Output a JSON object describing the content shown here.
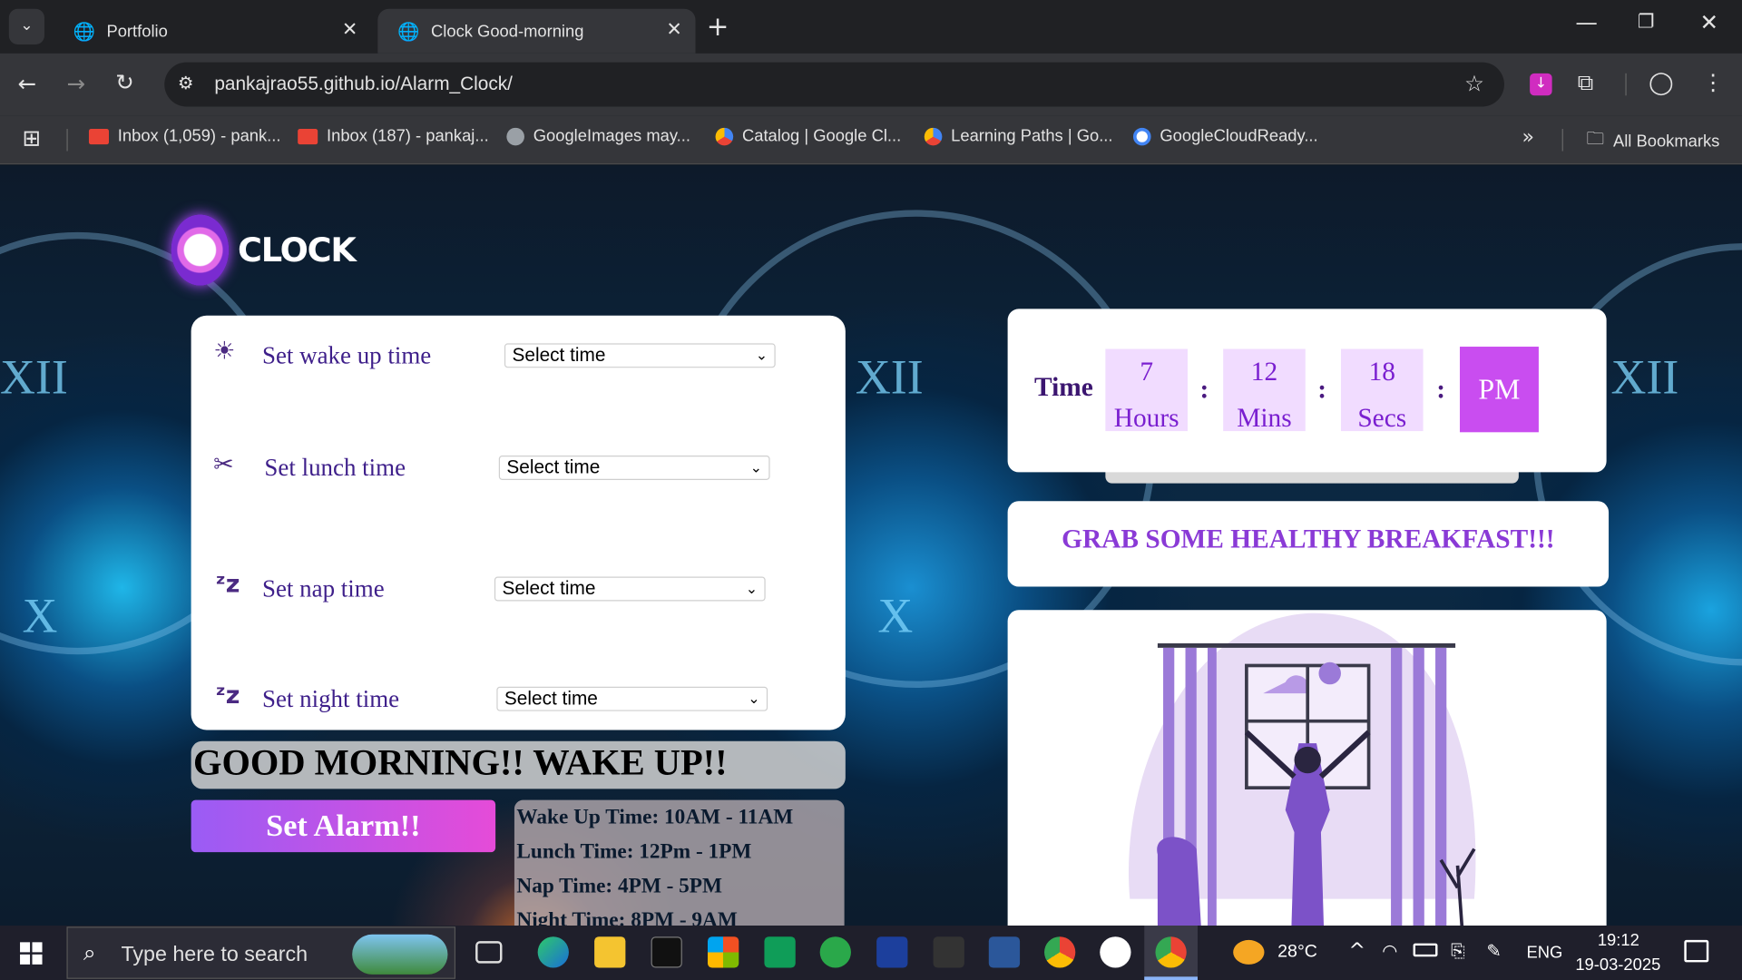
{
  "browser": {
    "tabs": [
      {
        "title": "Portfolio",
        "active": false
      },
      {
        "title": "Clock Good-morning",
        "active": true
      }
    ],
    "url": "pankajrao55.github.io/Alarm_Clock/",
    "bookmarks": [
      "Inbox (1,059) - pank...",
      "Inbox (187) - pankaj...",
      "GoogleImages may...",
      "Catalog | Google Cl...",
      "Learning Paths | Go...",
      "GoogleCloudReady..."
    ],
    "all_bookmarks": "All Bookmarks"
  },
  "app": {
    "logo": "CLOCK",
    "settings": [
      {
        "icon": "sun-icon",
        "glyph": "☀",
        "label": "Set wake up time",
        "select": "Select time"
      },
      {
        "icon": "cutlery-icon",
        "glyph": "✂",
        "label": "Set lunch time",
        "select": "Select time"
      },
      {
        "icon": "sleep-icon",
        "glyph": "z",
        "label": "Set nap time",
        "select": "Select time"
      },
      {
        "icon": "sleep-icon",
        "glyph": "z",
        "label": "Set night time",
        "select": "Select time"
      }
    ],
    "greeting": "GOOD MORNING!! WAKE UP!!",
    "button": "Set Alarm!!",
    "schedule": [
      "Wake Up Time: 10AM - 11AM",
      "Lunch Time: 12Pm - 1PM",
      "Nap Time: 4PM - 5PM",
      "Night Time: 8PM - 9AM"
    ],
    "clock": {
      "label": "Time",
      "hours": "7",
      "hours_label": "Hours",
      "mins": "12",
      "mins_label": "Mins",
      "secs": "18",
      "secs_label": "Secs",
      "sep": ":",
      "ampm": "PM"
    },
    "message": "GRAB SOME HEALTHY BREAKFAST!!!"
  },
  "taskbar": {
    "search": "Type here to search",
    "weather": "28°C",
    "lang": "ENG",
    "time": "19:12",
    "date": "19-03-2025"
  },
  "colors": {
    "accent": "#b44ce6",
    "purple_text": "#8a3ad6",
    "light_box": "#f1dcff"
  }
}
